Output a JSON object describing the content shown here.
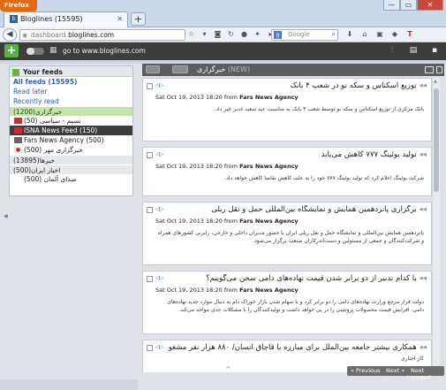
{
  "browser": {
    "menu_button": "Firefox",
    "tab_title": "Bloglines (15595)",
    "tab_favicon": "b",
    "new_tab": "+",
    "url_prefix": "dashboard.",
    "url_domain": "bloglines.com",
    "search_engine": "g",
    "search_placeholder": "Google",
    "search_icon": "magnifier-icon",
    "window_controls": [
      "—",
      "▭",
      "✕"
    ],
    "nav_icons": [
      "star-icon",
      "reload-icon",
      "rss-icon",
      "refresh-icon",
      "firefox-addon-icon",
      "puzzle-icon",
      "shield-icon"
    ],
    "nav_icons2": [
      "download-icon",
      "home-icon",
      "bookmark-icon",
      "feed-icon",
      "text-icon"
    ]
  },
  "toolbar": {
    "add_label": "+",
    "goto_label": "go to www.bloglines.com",
    "right_icons": [
      "sliders-icon",
      "page-icon",
      "profile-icon"
    ]
  },
  "sidebar": {
    "header": "Your feeds",
    "all_feeds": "All feeds (15595)",
    "read_later": "Read later",
    "recently_read": "Recently read",
    "folders": [
      {
        "label": "(1200)خبرگزاری",
        "active": true
      },
      {
        "label": "(13895)خبرها"
      },
      {
        "label": "(500)اخبار ایران"
      }
    ],
    "feeds_in_folder": [
      {
        "label": "(50) نسیم - سیاسی",
        "icon": "red"
      },
      {
        "label": "ISNA News Feed (150)",
        "icon": "red",
        "selected": true
      },
      {
        "label": "Fars News Agency (500)",
        "icon": "gray"
      },
      {
        "label": "(500) خبرگزاری مهر",
        "icon": "logo"
      }
    ],
    "sub_feed": "(500) صدای آلمان"
  },
  "main": {
    "header_title": "خبرگزاری",
    "header_count": "(NEW)",
    "items": [
      {
        "title": "توزیع اسکناس و سکه نو در شعب ۴ بانک",
        "date": "Sat Oct 19, 2013 18:20",
        "from": "from",
        "source": "Fars News Agency",
        "body": "بانک مرکزی از توزیع اسکناس و سکه نو توسط شعب ۴ بانک به مناسبت عید سعید غدیر خبر داد."
      },
      {
        "title": "تولید بوئینگ ۷۷۷ کاهش می‌یابد",
        "date": "Sat Oct 19, 2013 18:20",
        "from": "from",
        "source": "Fars News Agency",
        "body": "شرکت بوئینگ اعلام کرد که تولید بوئینگ ۷۷۷ خود را به علت کاهش تقاضا کاهش خواهد داد."
      },
      {
        "title": "برگزاری پانزدهمین همایش و نمایشگاه بین‌المللی حمل و نقل ریلی",
        "date": "Sat Oct 19, 2013 18:20",
        "from": "from",
        "source": "Fars News Agency",
        "body": "پانزدهمین همایش بین‌المللی و نمایشگاه حمل و نقل ریلی ایران با حضور مدیران داخلی و خارجی، رایزنی کشورهای همراه و شرکت‌کنندگان و جمعی از مسئولین و دست‌اندرکاران صنعت برگزار می‌شود."
      },
      {
        "title": "با کدام تدبیر از دو برابر شدن قیمت نهاده‌های دامی سخن می‌گوییم؟",
        "date": "Sat Oct 19, 2013 18:20",
        "from": "from",
        "source": "Fars News Agency",
        "body": "دولت قرار مرجع وزارت نهاده‌های دامی را دو برابر کرد و با سهام شدن بازار خوراک دام به دنبال موارد جدید نهاده‌های دامی، افزایش قیمت محصولات پروتئینی را در پی خواهد داشت و تولیدکنندگان را با مشکلات جدی مواجه می‌کند."
      },
      {
        "title": "همکاری بیشتر جامعه بین‌الملل برای مبارزه با قاچاق انسان/ ۸۸۰ هزار نفر مشغول",
        "date": "",
        "from": "",
        "source": "",
        "body": "کار اجباری"
      }
    ],
    "footer": {
      "prev": "« Previous",
      "next": "Next »",
      "next_unread": "Next unread",
      "scroll_mark": "^"
    }
  }
}
